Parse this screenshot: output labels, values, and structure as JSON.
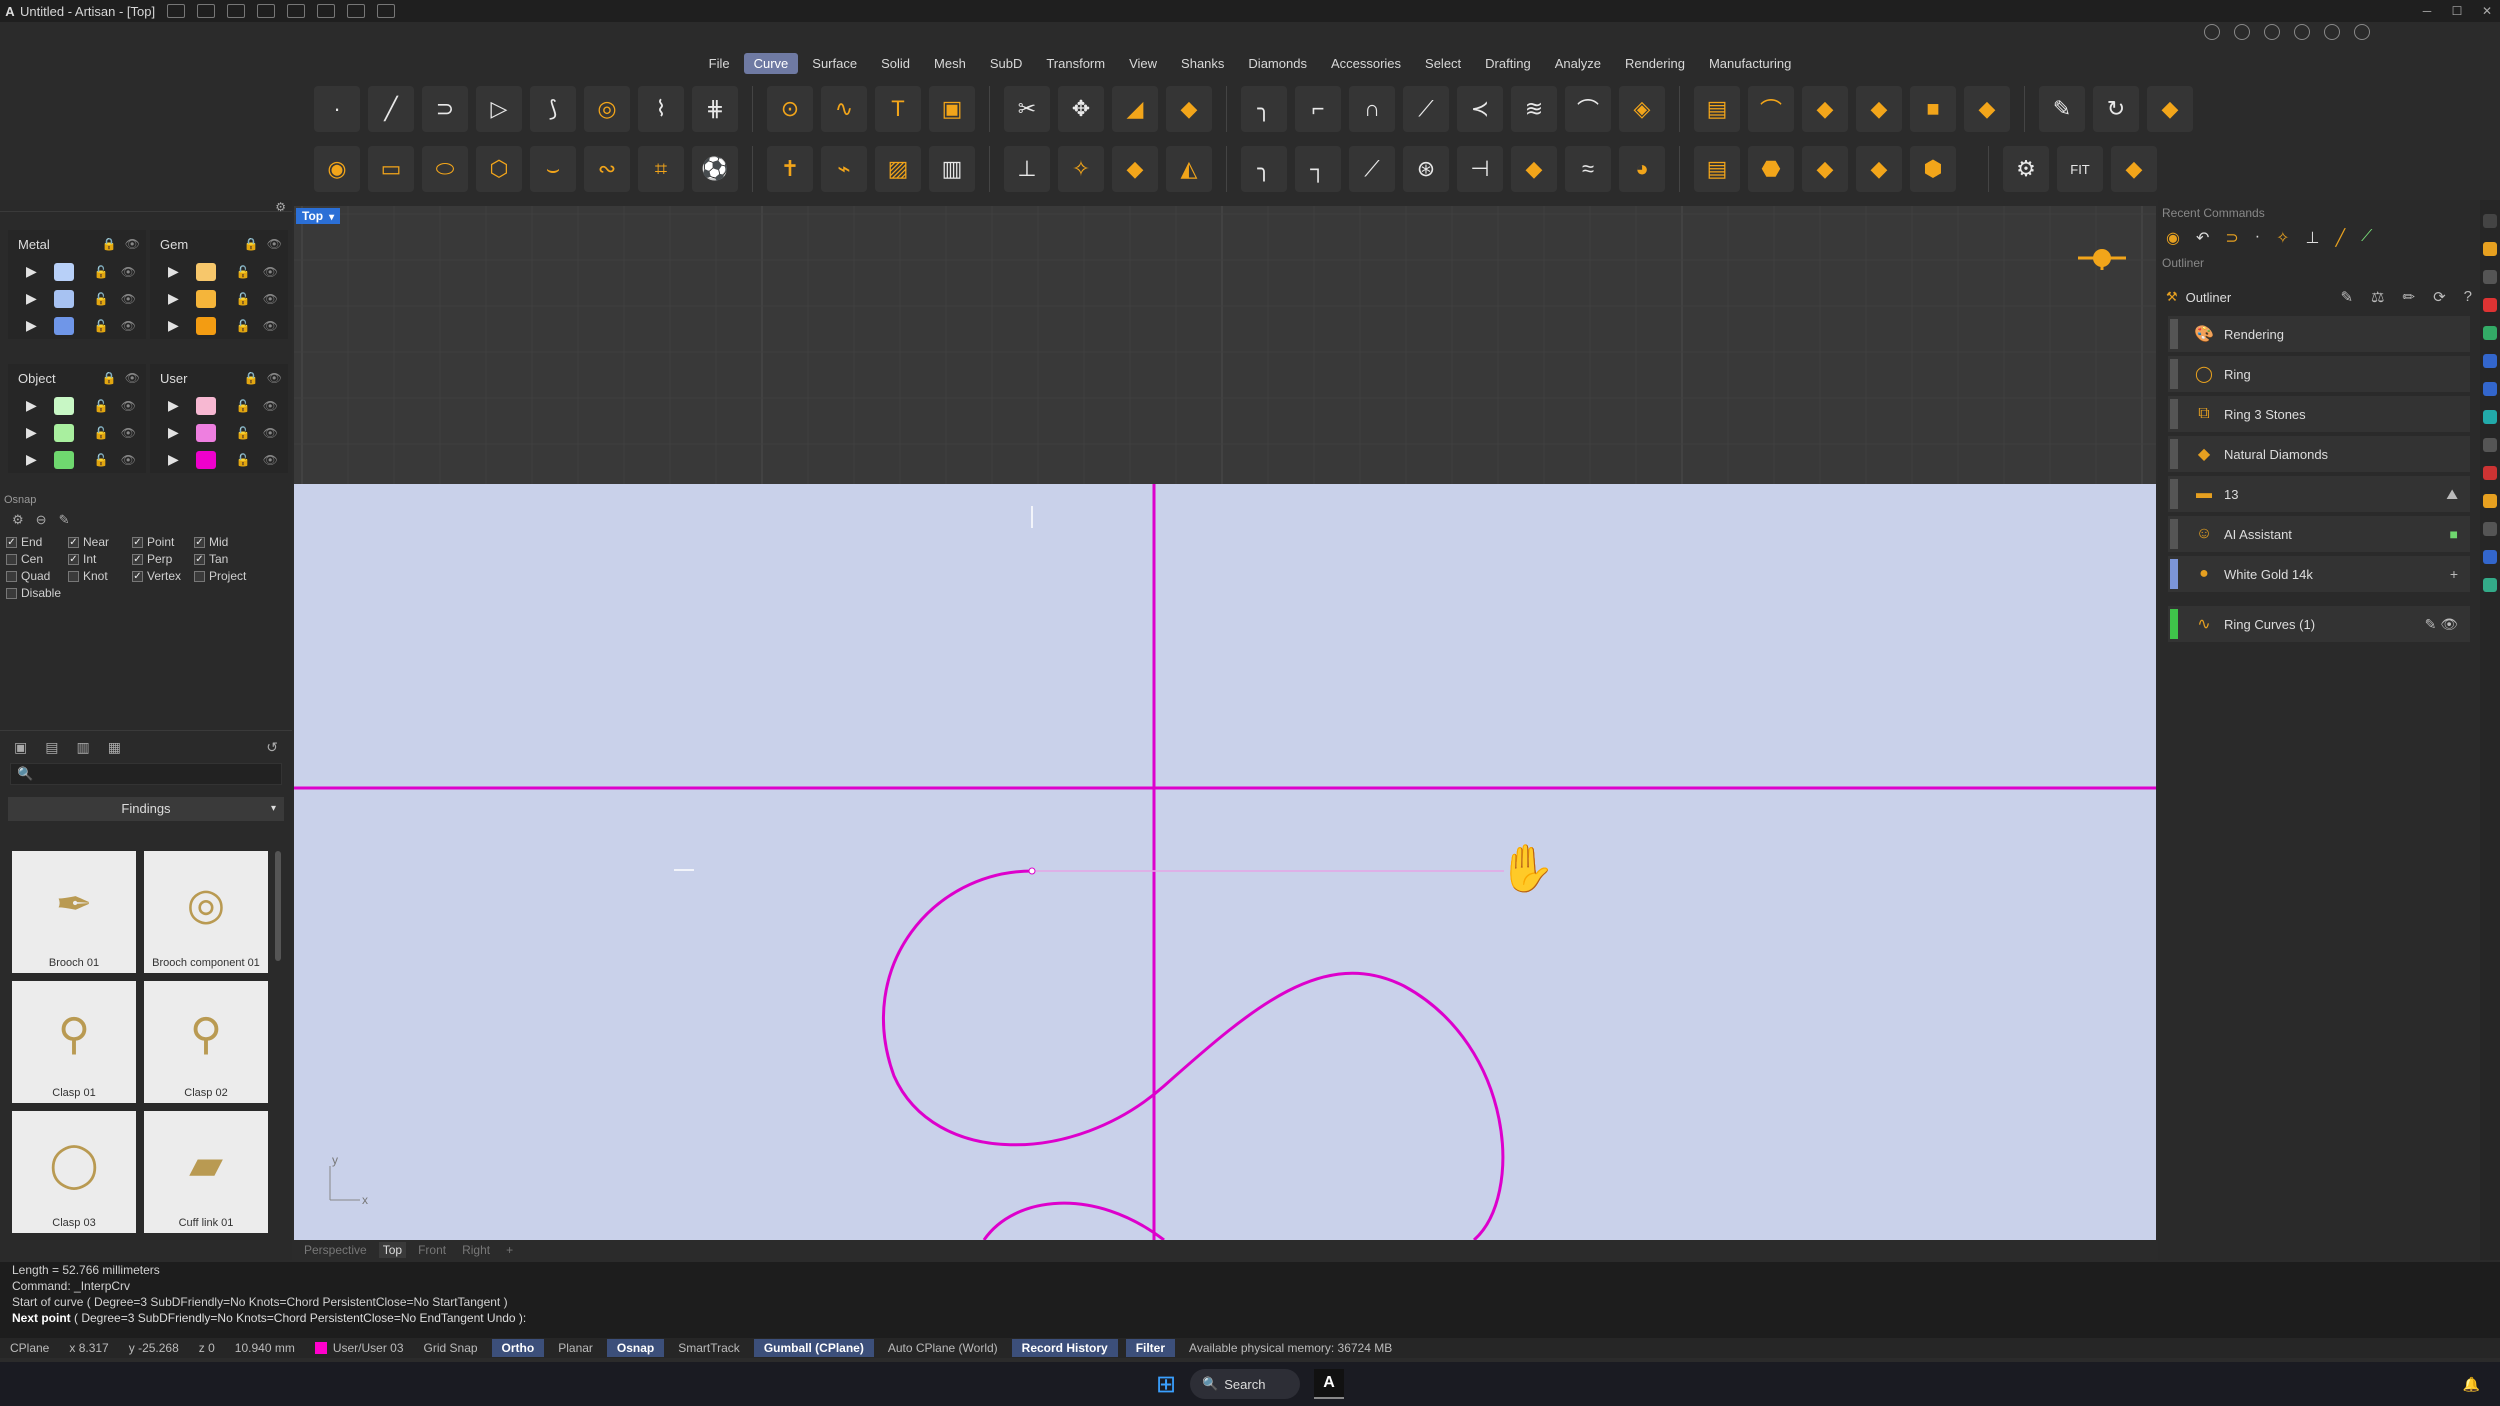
{
  "window": {
    "title": "Untitled - Artisan - [Top]",
    "logo": "A"
  },
  "menu": {
    "items": [
      "File",
      "Curve",
      "Surface",
      "Solid",
      "Mesh",
      "SubD",
      "Transform",
      "View",
      "Shanks",
      "Diamonds",
      "Accessories",
      "Select",
      "Drafting",
      "Analyze",
      "Rendering",
      "Manufacturing"
    ],
    "active": "Curve"
  },
  "layers": {
    "metal": {
      "title": "Metal",
      "swatches": [
        "#b8d0f8",
        "#a7c2f2",
        "#6f96e8"
      ]
    },
    "gem": {
      "title": "Gem",
      "swatches": [
        "#f7c76b",
        "#f5b53a",
        "#f39c12"
      ]
    },
    "object": {
      "title": "Object",
      "swatches": [
        "#c8f7c5",
        "#a9ef9f",
        "#6fd86f"
      ]
    },
    "user": {
      "title": "User",
      "swatches": [
        "#f7b8d2",
        "#ee7fe0",
        "#ee00cc"
      ]
    }
  },
  "osnap": {
    "title": "Osnap",
    "options": [
      {
        "label": "End",
        "checked": true
      },
      {
        "label": "Near",
        "checked": true
      },
      {
        "label": "Point",
        "checked": true
      },
      {
        "label": "Mid",
        "checked": true
      },
      {
        "label": "Cen",
        "checked": false
      },
      {
        "label": "Int",
        "checked": true
      },
      {
        "label": "Perp",
        "checked": true
      },
      {
        "label": "Tan",
        "checked": true
      },
      {
        "label": "Quad",
        "checked": false
      },
      {
        "label": "Knot",
        "checked": false
      },
      {
        "label": "Vertex",
        "checked": true
      },
      {
        "label": "Project",
        "checked": false
      },
      {
        "label": "Disable",
        "checked": false
      }
    ]
  },
  "library": {
    "category": "Findings",
    "items": [
      {
        "label": "Brooch 01",
        "icon": "✒"
      },
      {
        "label": "Brooch component 01",
        "icon": "◎"
      },
      {
        "label": "Clasp 01",
        "icon": "⚲"
      },
      {
        "label": "Clasp 02",
        "icon": "⚲"
      },
      {
        "label": "Clasp 03",
        "icon": "◯"
      },
      {
        "label": "Cuff link 01",
        "icon": "▰"
      }
    ]
  },
  "viewport": {
    "label": "Top",
    "tabs": [
      "Perspective",
      "Top",
      "Front",
      "Right"
    ],
    "active_tab": "Top",
    "add_tab": "+",
    "axis_x": "x",
    "axis_y": "y"
  },
  "right_panel": {
    "recent_commands_title": "Recent Commands",
    "outliner_title": "Outliner",
    "outliner_tab": "Outliner",
    "rows": [
      {
        "label": "Rendering",
        "icon": "🎨",
        "stripe": "#555555"
      },
      {
        "label": "Ring",
        "icon": "◯",
        "stripe": "#555555"
      },
      {
        "label": "Ring 3 Stones",
        "icon": "⧉",
        "stripe": "#555555"
      },
      {
        "label": "Natural Diamonds",
        "icon": "◆",
        "stripe": "#555555"
      },
      {
        "label": "13",
        "icon": "▬",
        "stripe": "#555555"
      },
      {
        "label": "AI Assistant",
        "icon": "☺",
        "stripe": "#555555"
      },
      {
        "label": "White Gold 14k",
        "icon": "●",
        "stripe": "#7c95d8"
      },
      {
        "label": "Ring Curves (1)",
        "icon": "∿",
        "stripe": "#3fc34a"
      }
    ]
  },
  "command": {
    "history": [
      "Length = 52.766 millimeters",
      "Command: _InterpCrv",
      "Start of curve ( Degree=3  SubDFriendly=No  Knots=Chord  PersistentClose=No  StartTangent )"
    ],
    "prompt_label": "Next point",
    "prompt_options": "( Degree=3  SubDFriendly=No  Knots=Chord  PersistentClose=No  EndTangent  Undo ):"
  },
  "status": {
    "cplane": "CPlane",
    "x": "x 8.317",
    "y": "y -25.268",
    "z": "z 0",
    "dist": "10.940 mm",
    "layer": "User/User 03",
    "grid_snap": "Grid Snap",
    "ortho": "Ortho",
    "planar": "Planar",
    "osnap": "Osnap",
    "smarttrack": "SmartTrack",
    "gumball": "Gumball (CPlane)",
    "auto_cplane": "Auto CPlane (World)",
    "record_history": "Record History",
    "filter": "Filter",
    "memory": "Available physical memory: 36724 MB"
  },
  "taskbar": {
    "search": "Search",
    "app": "A"
  },
  "colors": {
    "curve": "#dd00cc",
    "plane": "#c9d1ea",
    "accent": "#f2a51a",
    "selection": "#2b6fd6"
  }
}
